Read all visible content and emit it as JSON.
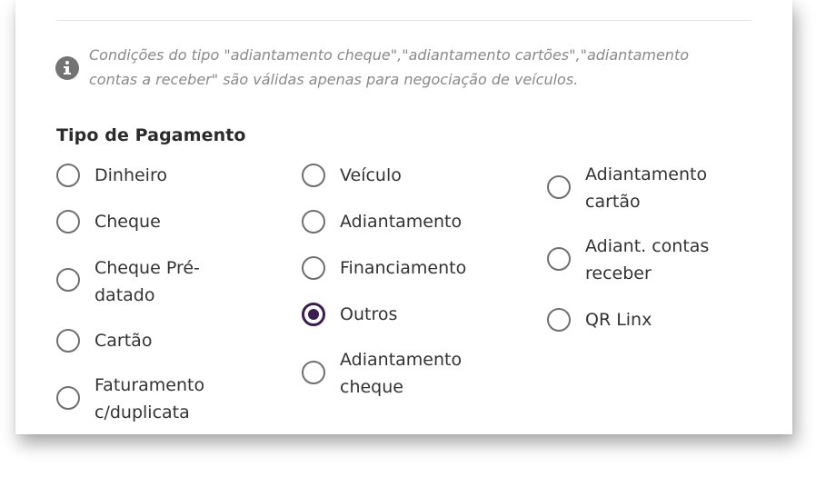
{
  "info": {
    "text": "Condições do tipo \"adiantamento cheque\",\"adiantamento cartões\",\"adiantamento contas a receber\" são válidas apenas para negociação de veículos."
  },
  "payment": {
    "title": "Tipo de Pagamento",
    "selected": "Outros",
    "columns": [
      {
        "options": [
          {
            "label": "Dinheiro",
            "checked": false
          },
          {
            "label": "Cheque",
            "checked": false
          },
          {
            "label": "Cheque Pré-datado",
            "checked": false
          },
          {
            "label": "Cartão",
            "checked": false
          },
          {
            "label": "Faturamento c/duplicata",
            "checked": false
          }
        ]
      },
      {
        "options": [
          {
            "label": "Veículo",
            "checked": false
          },
          {
            "label": "Adiantamento",
            "checked": false
          },
          {
            "label": "Financiamento",
            "checked": false
          },
          {
            "label": "Outros",
            "checked": true
          },
          {
            "label": "Adiantamento cheque",
            "checked": false
          }
        ]
      },
      {
        "options": [
          {
            "label": "Adiantamento cartão",
            "checked": false
          },
          {
            "label": "Adiant. contas receber",
            "checked": false
          },
          {
            "label": "QR Linx",
            "checked": false
          }
        ]
      }
    ]
  },
  "colors": {
    "radio_checked": "#3a1e4f",
    "radio_border": "#707070",
    "info_icon": "#737373"
  }
}
